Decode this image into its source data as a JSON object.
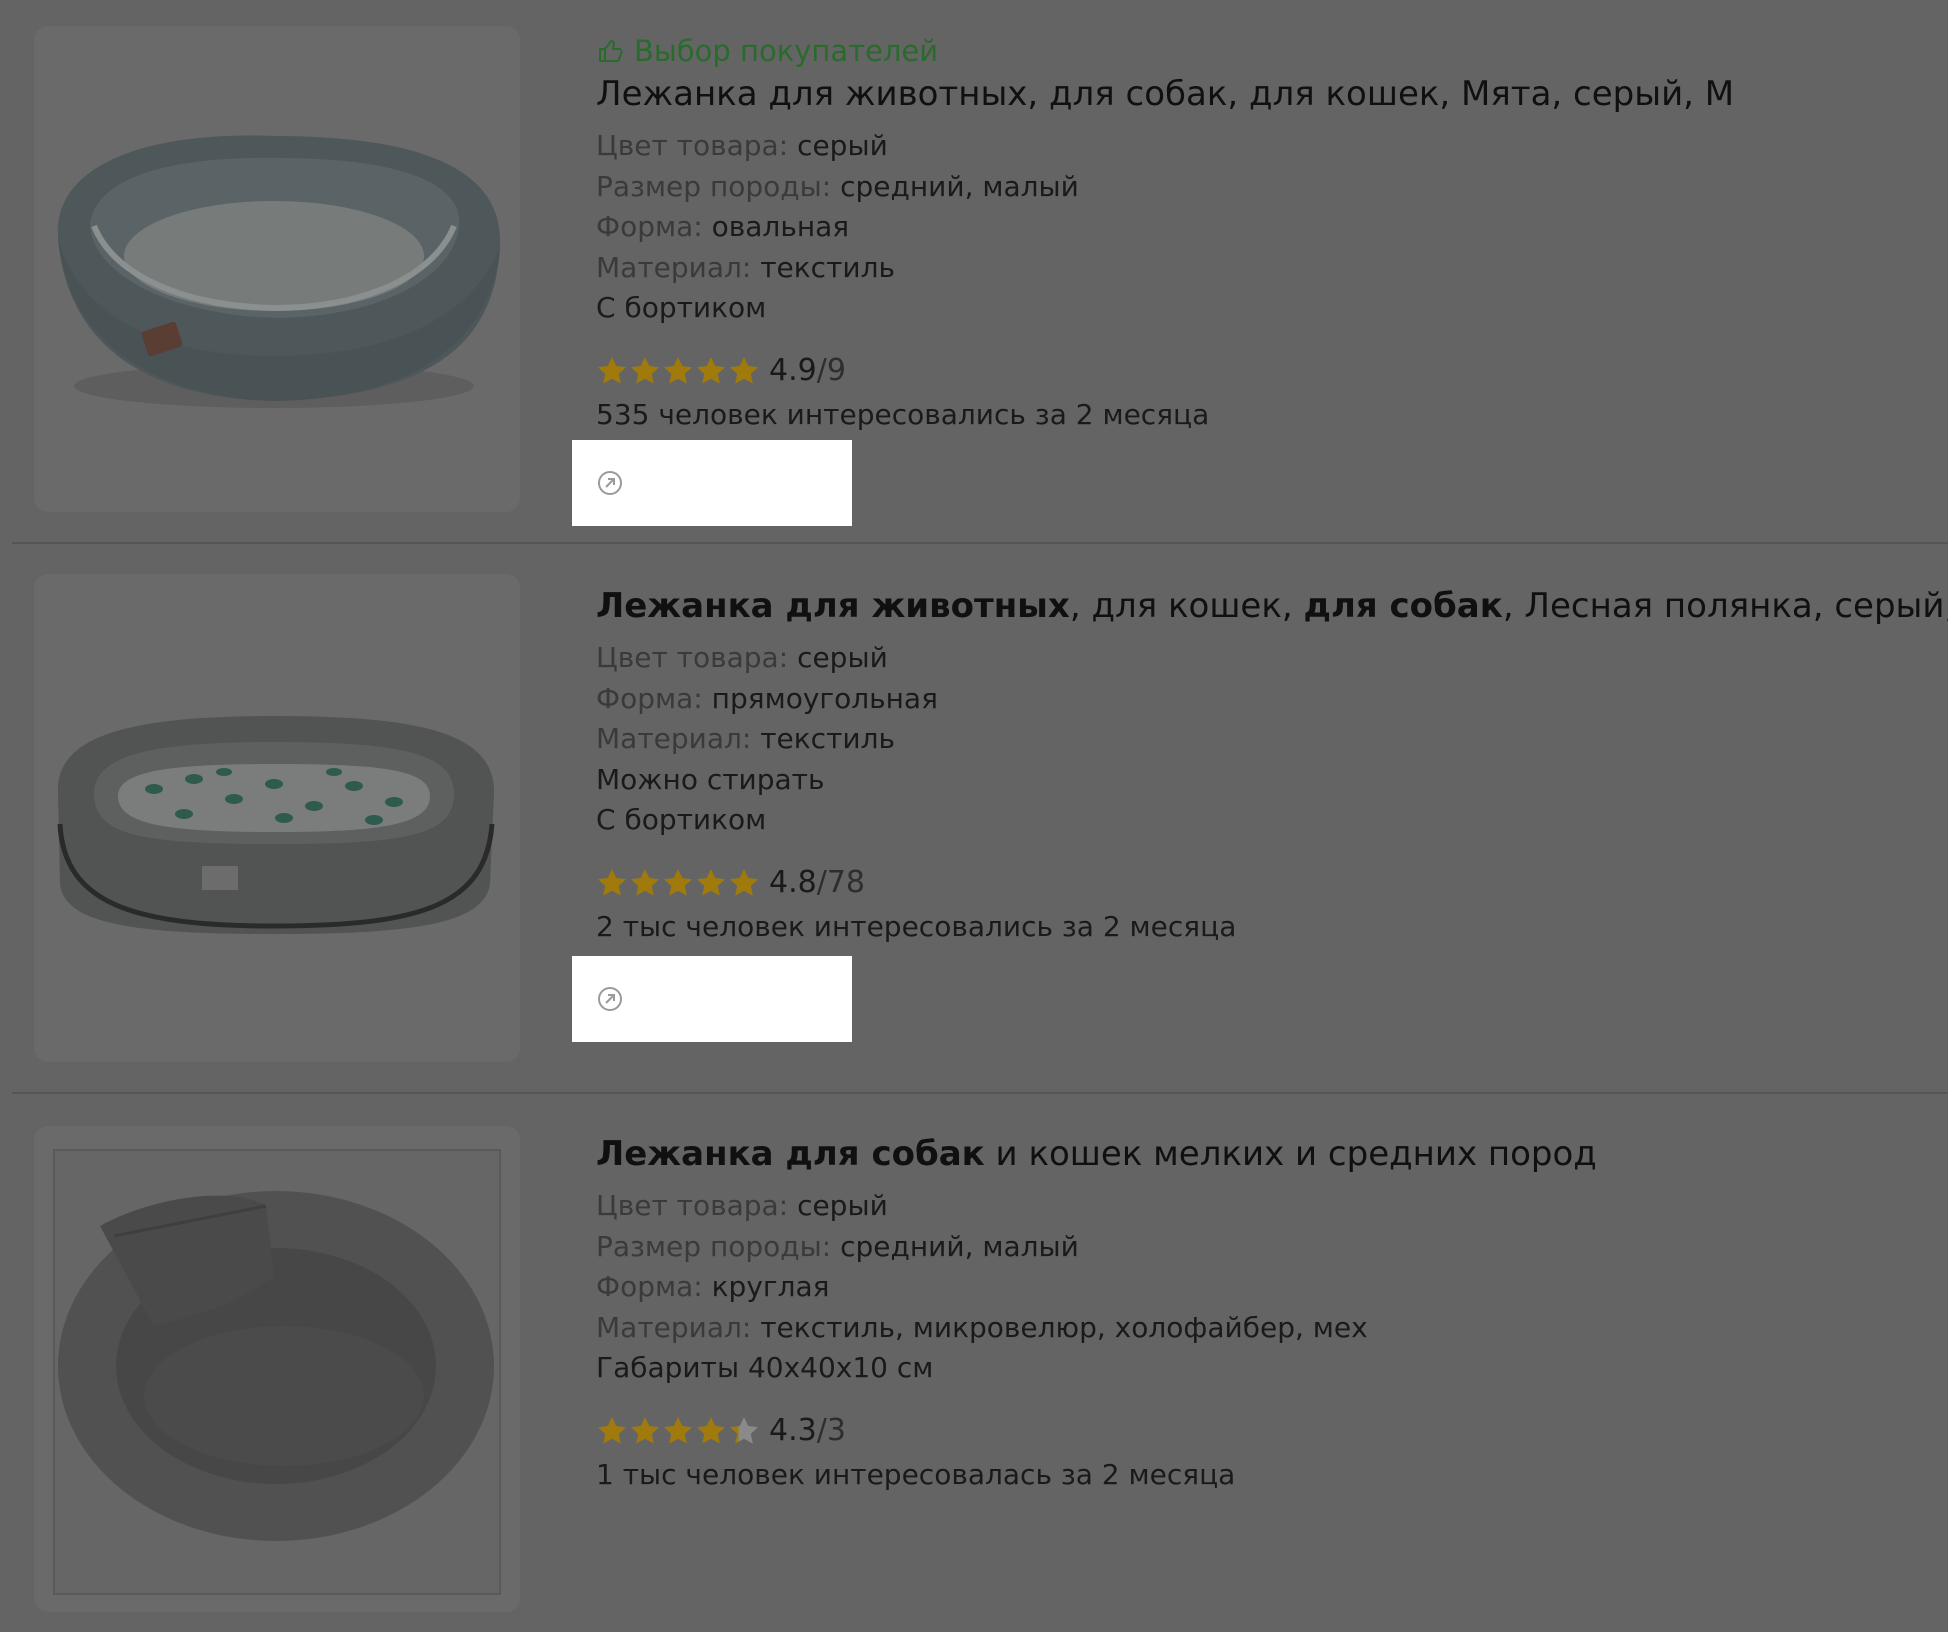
{
  "colors": {
    "overlay": "#646464",
    "badge": "#2a6b2d",
    "star_filled": "#a07a0c",
    "star_empty": "#8a8a8a"
  },
  "products": [
    {
      "badge": "Выбор покупателей",
      "title_parts": [
        {
          "text": "Лежанка для животных, для собак, для кошек, Мята, серый, М",
          "bold": false
        }
      ],
      "props": [
        {
          "key": "Цвет товара:",
          "value": "серый"
        },
        {
          "key": "Размер породы:",
          "value": "средний, малый"
        },
        {
          "key": "Форма:",
          "value": "овальная"
        },
        {
          "key": "Материал:",
          "value": "текстиль"
        },
        {
          "key": "",
          "value": "С бортиком"
        }
      ],
      "rating": {
        "score": "4.9",
        "count": "/9",
        "stars": 5
      },
      "interest": "535 человек интересовались за 2 месяца",
      "link_icon": "external-link-icon",
      "image_icon": "oval-pet-bed-image"
    },
    {
      "badge": "",
      "title_parts": [
        {
          "text": "Лежанка для животных",
          "bold": true
        },
        {
          "text": ", для кошек, ",
          "bold": false
        },
        {
          "text": "для собак",
          "bold": true
        },
        {
          "text": ", Лесная полянка, серый, М",
          "bold": false
        }
      ],
      "props": [
        {
          "key": "Цвет товара:",
          "value": "серый"
        },
        {
          "key": "Форма:",
          "value": "прямоугольная"
        },
        {
          "key": "Материал:",
          "value": "текстиль"
        },
        {
          "key": "",
          "value": "Можно стирать"
        },
        {
          "key": "",
          "value": "С бортиком"
        }
      ],
      "rating": {
        "score": "4.8",
        "count": "/78",
        "stars": 5
      },
      "interest": "2 тыс человек интересовались за 2 месяца",
      "link_icon": "external-link-icon",
      "image_icon": "rectangular-pet-bed-image"
    },
    {
      "badge": "",
      "title_parts": [
        {
          "text": "Лежанка для собак",
          "bold": true
        },
        {
          "text": " и кошек мелких и средних пород",
          "bold": false
        }
      ],
      "props": [
        {
          "key": "Цвет товара:",
          "value": "серый"
        },
        {
          "key": "Размер породы:",
          "value": "средний, малый"
        },
        {
          "key": "Форма:",
          "value": "круглая"
        },
        {
          "key": "Материал:",
          "value": "текстиль, микровелюр, холофайбер, мех"
        },
        {
          "key": "",
          "value": "Габариты 40x40x10 см"
        }
      ],
      "rating": {
        "score": "4.3",
        "count": "/3",
        "stars": 4.3
      },
      "interest": "1 тыс человек интересовалась за 2 месяца",
      "link_icon": "",
      "image_icon": "round-pet-bed-image"
    }
  ]
}
